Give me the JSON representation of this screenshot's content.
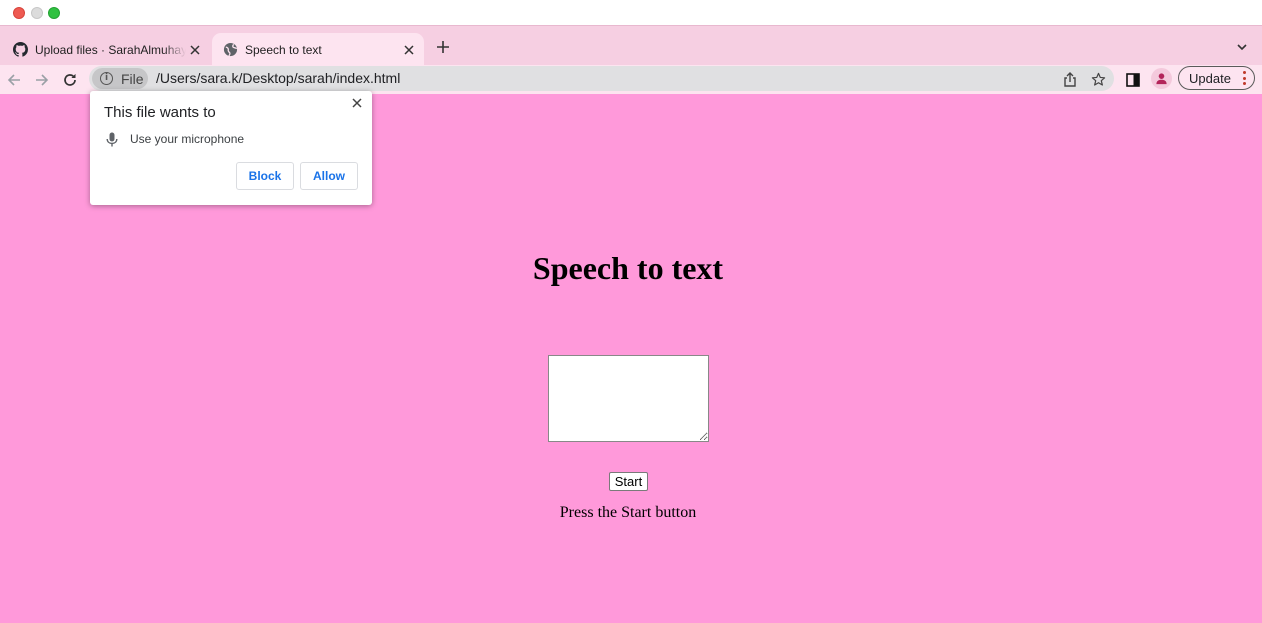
{
  "browser": {
    "tabs": [
      {
        "title": "Upload files · SarahAlmuhaya/Speech-to-text",
        "favicon": "github-icon",
        "active": false
      },
      {
        "title": "Speech to text",
        "favicon": "globe-icon",
        "active": true
      }
    ],
    "address": {
      "chip_label": "File",
      "url": "/Users/sara.k/Desktop/sarah/index.html"
    },
    "update_label": "Update"
  },
  "permission_prompt": {
    "title": "This file wants to",
    "request": "Use your microphone",
    "block_label": "Block",
    "allow_label": "Allow"
  },
  "page": {
    "heading": "Speech to text",
    "textarea_value": "",
    "start_label": "Start",
    "status": "Press the Start button",
    "background_color": "#ff99da"
  }
}
